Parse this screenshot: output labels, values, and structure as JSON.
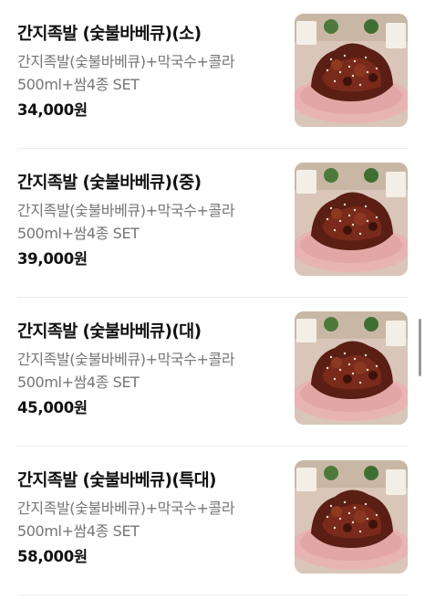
{
  "menu": {
    "items": [
      {
        "name": "간지족발 (숯불바베큐)(소)",
        "description": "간지족발(숯불바베큐)+막국수+콜라500ml+쌈4종 SET",
        "price": "34,000원",
        "image_icon": "food-photo-icon"
      },
      {
        "name": "간지족발 (숯불바베큐)(중)",
        "description": "간지족발(숯불바베큐)+막국수+콜라500ml+쌈4종 SET",
        "price": "39,000원",
        "image_icon": "food-photo-icon"
      },
      {
        "name": "간지족발 (숯불바베큐)(대)",
        "description": "간지족발(숯불바베큐)+막국수+콜라500ml+쌈4종 SET",
        "price": "45,000원",
        "image_icon": "food-photo-icon"
      },
      {
        "name": "간지족발 (숯불바베큐)(특대)",
        "description": "간지족발(숯불바베큐)+막국수+콜라500ml+쌈4종 SET",
        "price": "58,000원",
        "image_icon": "food-photo-icon"
      }
    ]
  },
  "colors": {
    "text_primary": "#111111",
    "text_secondary": "#767676",
    "divider": "#ececec",
    "plate": "#e7b7b4",
    "meat": "#5a1e14"
  }
}
